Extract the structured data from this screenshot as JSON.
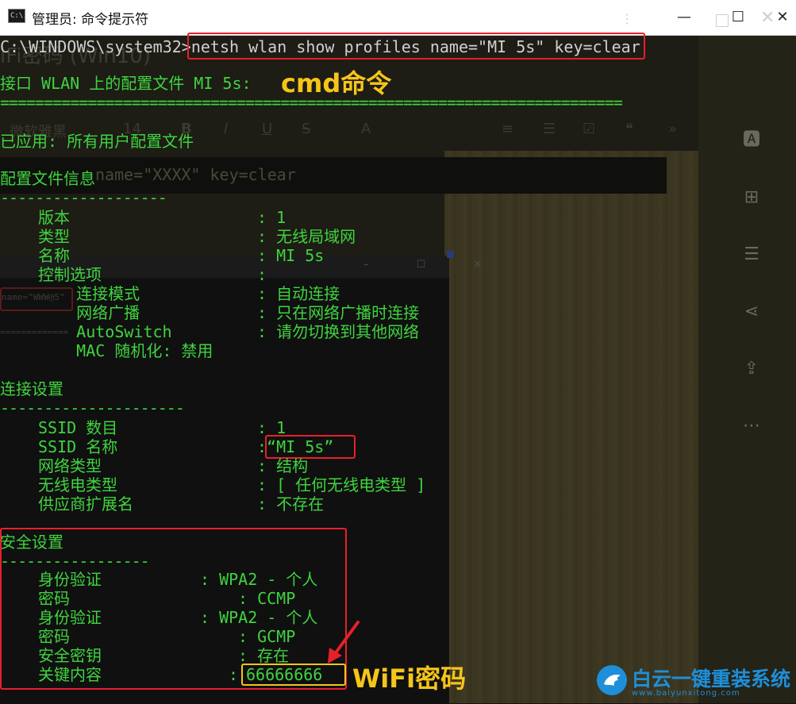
{
  "window": {
    "title": "管理员: 命令提示符",
    "icon_text": "C:\\.",
    "minimize": "—",
    "maximize": "☐",
    "close": "✕"
  },
  "background_ghost": {
    "heading": "iFi密码 (Win10)",
    "toolbar": [
      "微软雅黑",
      "14",
      "B",
      "I",
      "U",
      "S",
      "A",
      "≡",
      "☰",
      "☑",
      "❝",
      "»"
    ],
    "code": "name=\"XXXX\" key=clear",
    "inner_cmd": "name=\"WWW@5\"",
    "inner_sep": "============="
  },
  "console": {
    "prompt": "C:\\WINDOWS\\system32>",
    "command": "netsh wlan show profiles name=\"MI 5s\" key=clear",
    "interface_line": "接口 WLAN 上的配置文件 MI 5s:",
    "separator_long": "=======================================================================",
    "applied": "已应用: 所有用户配置文件",
    "profile_info_header": "配置文件信息",
    "separator_short": "-------------------",
    "profile_rows": [
      {
        "label": "版本",
        "value": ": 1"
      },
      {
        "label": "类型",
        "value": ": 无线局域网"
      },
      {
        "label": "名称",
        "value": ": MI 5s"
      },
      {
        "label": "控制选项",
        "value": ":"
      },
      {
        "label": "    连接模式",
        "value": ": 自动连接"
      },
      {
        "label": "    网络广播",
        "value": ": 只在网络广播时连接"
      },
      {
        "label": "    AutoSwitch",
        "value": ": 请勿切换到其他网络"
      },
      {
        "label": "    MAC 随机化: 禁用",
        "value": ""
      }
    ],
    "connect_header": "连接设置",
    "connect_sep": "---------------------",
    "connect_rows": [
      {
        "label": "SSID 数目",
        "value": ": 1"
      },
      {
        "label": "SSID 名称",
        "value": ":“MI 5s”"
      },
      {
        "label": "网络类型",
        "value": ": 结构"
      },
      {
        "label": "无线电类型",
        "value": ": [ 任何无线电类型 ]"
      },
      {
        "label": "供应商扩展名",
        "value": ": 不存在"
      }
    ],
    "security_header": "安全设置",
    "security_sep": "-----------------",
    "security_rows": [
      {
        "label": "身份验证",
        "value": ": WPA2 - 个人"
      },
      {
        "label": "密码",
        "value": ": CCMP"
      },
      {
        "label": "身份验证",
        "value": ": WPA2 - 个人"
      },
      {
        "label": "密码",
        "value": ": GCMP"
      },
      {
        "label": "安全密钥",
        "value": ": 存在"
      },
      {
        "label": "关键内容",
        "value": ":"
      }
    ],
    "key_content": "66666666"
  },
  "annotations": {
    "cmd_label": "cmd命令",
    "wifi_label": "WiFi密码",
    "highlight_red": "#e8202a",
    "highlight_yellow": "#f5c518"
  },
  "watermark": {
    "name": "白云一键重装系统",
    "url": "www.baiyunxitong.com"
  },
  "right_pane_icons": [
    "text-box-icon",
    "add-box-icon",
    "document-icon",
    "share-icon",
    "export-icon",
    "more-icon"
  ]
}
